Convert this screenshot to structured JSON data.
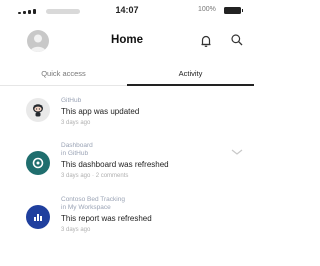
{
  "status_bar": {
    "time": "14:07",
    "battery": "100%"
  },
  "nav": {
    "title": "Home"
  },
  "tabs": [
    {
      "label": "Quick access",
      "selected": false
    },
    {
      "label": "Activity",
      "selected": true
    }
  ],
  "activity": [
    {
      "icon": "github-octocat-icon",
      "icon_bg": "#e9e9e9",
      "meta_lines": [
        "GitHub"
      ],
      "message": "This app was updated",
      "time": "3 days ago"
    },
    {
      "icon": "dashboard-icon",
      "icon_bg": "#1f6e6e",
      "meta_lines": [
        "Dashboard",
        "in GitHub"
      ],
      "message": "This dashboard was refreshed",
      "time": "3 days ago · 2 comments"
    },
    {
      "icon": "report-icon",
      "icon_bg": "#1f3f9e",
      "meta_lines": [
        "Contoso Bed Tracking",
        "in My Workspace"
      ],
      "message": "This report was refreshed",
      "time": "3 days ago"
    }
  ]
}
